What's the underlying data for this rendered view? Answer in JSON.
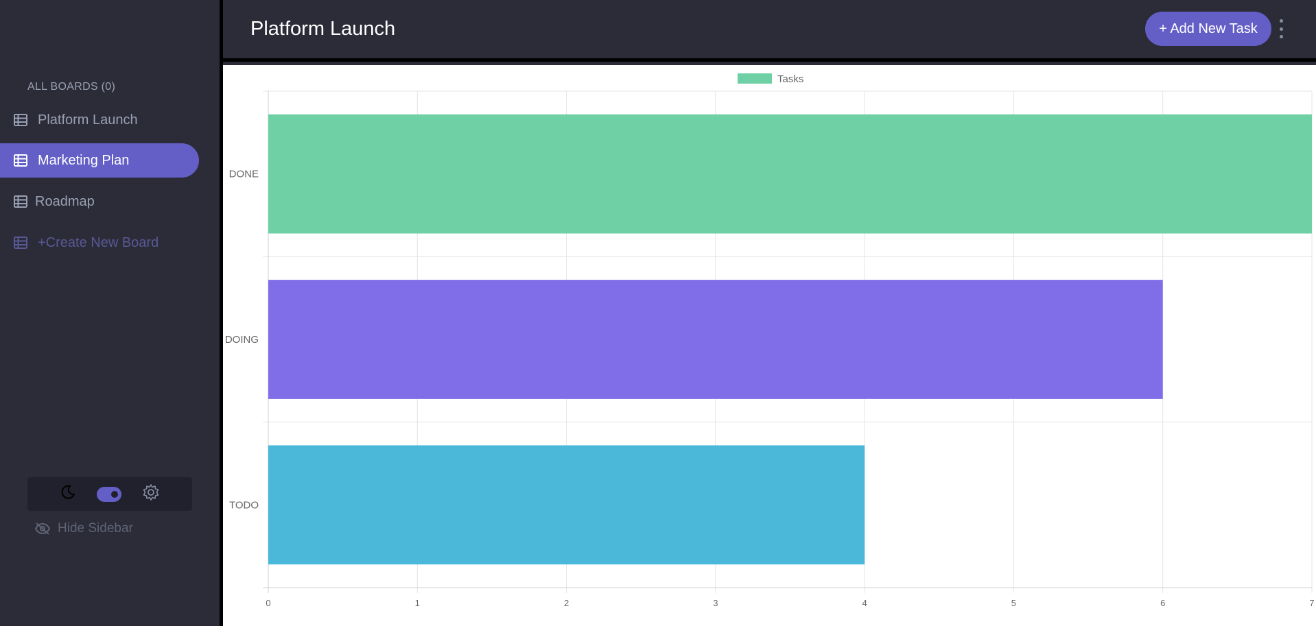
{
  "sidebar": {
    "boards_title": "ALL BOARDS  (0)",
    "items": [
      {
        "label": "Platform Launch",
        "icon": "board-icon",
        "active": false
      },
      {
        "label": "Marketing Plan",
        "icon": "board-icon",
        "active": true
      },
      {
        "label": "Roadmap",
        "icon": "board-icon",
        "active": false
      },
      {
        "label": "+Create New Board",
        "icon": "board-icon",
        "active": false
      }
    ],
    "theme": {
      "dark_icon": "moon-icon",
      "light_icon": "gear-icon",
      "toggle_on": true
    },
    "hide_label": "Hide Sidebar",
    "hide_icon": "eye-slash-icon"
  },
  "header": {
    "title": "Platform Launch",
    "add_task_label": "+ Add New Task",
    "menu_icon": "kebab-menu-icon"
  },
  "colors": {
    "accent": "#635fc7",
    "sidebar_bg": "#2b2c37",
    "done": "#6fd0a6",
    "doing": "#7f6ee8",
    "todo": "#4bb8da"
  },
  "chart_data": {
    "type": "bar",
    "orientation": "horizontal",
    "categories": [
      "DONE",
      "DOING",
      "TODO"
    ],
    "series": [
      {
        "name": "Tasks",
        "values": [
          7,
          6,
          4
        ]
      }
    ],
    "bar_colors": [
      "#6fd0a6",
      "#7f6ee8",
      "#4bb8da"
    ],
    "xlim": [
      0,
      7
    ],
    "x_ticks": [
      0,
      1,
      2,
      3,
      4,
      5,
      6,
      7
    ],
    "grid": true,
    "legend": "top-center"
  }
}
